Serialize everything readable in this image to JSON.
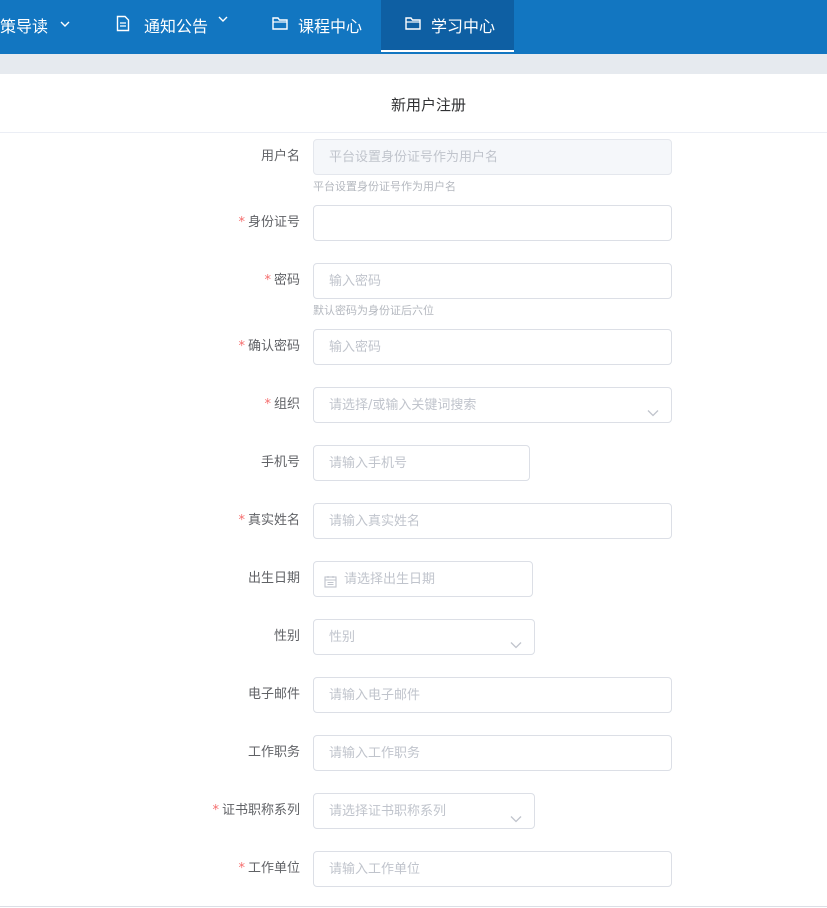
{
  "nav": {
    "items": [
      {
        "label": "政策导读",
        "icon": "chevron-down-icon"
      },
      {
        "label": "通知公告",
        "icon": "document-icon"
      },
      {
        "label": "课程中心",
        "icon": "folder-icon"
      },
      {
        "label": "学习中心",
        "icon": "folder-icon"
      }
    ],
    "active": "学习中心",
    "colors": {
      "bar": "#1276c1",
      "active": "#0e5fa3"
    }
  },
  "form": {
    "title": "新用户注册",
    "required_mark": "*",
    "fields": {
      "username": {
        "label": "用户名",
        "placeholder": "平台设置身份证号作为用户名",
        "hint": "平台设置身份证号作为用户名",
        "disabled": true
      },
      "id_number": {
        "label": "身份证号",
        "placeholder": "",
        "required": true
      },
      "password": {
        "label": "密码",
        "placeholder": "输入密码",
        "hint": "默认密码为身份证后六位",
        "required": true
      },
      "confirm_password": {
        "label": "确认密码",
        "placeholder": "输入密码",
        "required": true
      },
      "organization": {
        "label": "组织",
        "placeholder": "请选择/或输入关键词搜索",
        "required": true
      },
      "phone": {
        "label": "手机号",
        "placeholder": "请输入手机号"
      },
      "real_name": {
        "label": "真实姓名",
        "placeholder": "请输入真实姓名",
        "required": true
      },
      "birth_date": {
        "label": "出生日期",
        "placeholder": "请选择出生日期"
      },
      "gender": {
        "label": "性别",
        "placeholder": "性别"
      },
      "email": {
        "label": "电子邮件",
        "placeholder": "请输入电子邮件"
      },
      "job_title": {
        "label": "工作职务",
        "placeholder": "请输入工作职务"
      },
      "cert_series": {
        "label": "证书职称系列",
        "placeholder": "请选择证书职称系列",
        "required": true
      },
      "work_unit": {
        "label": "工作单位",
        "placeholder": "请输入工作单位",
        "required": true
      }
    }
  },
  "colors": {
    "required": "#f56c6c",
    "placeholder": "#c0c4cc",
    "label": "#606266"
  }
}
